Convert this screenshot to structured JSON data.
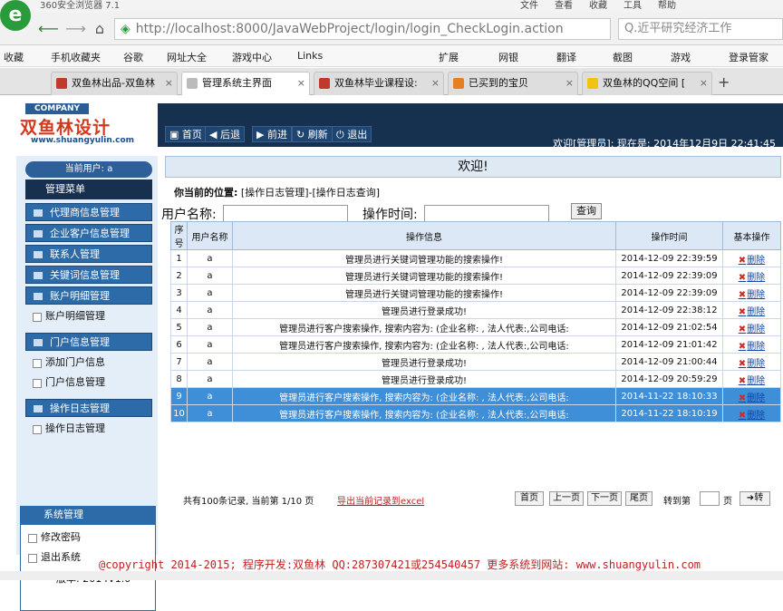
{
  "browser": {
    "title": "360安全浏览器 7.1",
    "menu": [
      "文件",
      "查看",
      "收藏",
      "工具",
      "帮助"
    ],
    "url": "http://localhost:8000/JavaWebProject/login/login_CheckLogin.action",
    "search": "Q.近平研究经济工作",
    "favorites": [
      "收藏",
      "手机收藏夹",
      "谷歌",
      "网址大全",
      "游戏中心",
      "Links",
      "扩展",
      "网银",
      "翻译",
      "截图",
      "游戏",
      "登录管家"
    ],
    "tabs": [
      {
        "label": "双鱼林出品-双鱼林",
        "color": "#c0392b"
      },
      {
        "label": "管理系统主界面",
        "color": "#999999"
      },
      {
        "label": "双鱼林毕业课程设:",
        "color": "#c0392b"
      },
      {
        "label": "已买到的宝贝",
        "color": "#e67e22"
      },
      {
        "label": "双鱼林的QQ空间 [",
        "color": "#f1c40f"
      }
    ]
  },
  "app": {
    "company": "COMPANY",
    "brand": "双鱼林设计",
    "brand_url": "www.shuangyulin.com",
    "toolbar": [
      "首页",
      "后退",
      "前进",
      "刷新",
      "退出"
    ],
    "welcome": "欢迎[管理员]: 现在是: 2014年12月9日 22:41:45",
    "current_user": "当前用户: a",
    "menu_title": "管理菜单",
    "sidebar": [
      {
        "type": "head",
        "label": "代理商信息管理"
      },
      {
        "type": "head",
        "label": "企业客户信息管理"
      },
      {
        "type": "head",
        "label": "联系人管理"
      },
      {
        "type": "head",
        "label": "关键词信息管理"
      },
      {
        "type": "head",
        "label": "账户明细管理"
      },
      {
        "type": "item",
        "label": "账户明细管理"
      },
      {
        "type": "head",
        "label": "门户信息管理"
      },
      {
        "type": "item",
        "label": "添加门户信息"
      },
      {
        "type": "item",
        "label": "门户信息管理"
      },
      {
        "type": "head",
        "label": "操作日志管理"
      },
      {
        "type": "item",
        "label": "操作日志管理"
      }
    ],
    "system": {
      "title": "系统管理",
      "items": [
        "修改密码",
        "退出系统"
      ],
      "version": "版本: 2014V1.0"
    },
    "main": {
      "welcome_bar": "欢迎!",
      "crumb_label": "你当前的位置:",
      "crumb": "[操作日志管理]-[操作日志查询]",
      "username_label": "用户名称:",
      "time_label": "操作时间:",
      "query": "查询",
      "columns": [
        "序号",
        "用户名称",
        "操作信息",
        "操作时间",
        "基本操作"
      ],
      "rows": [
        [
          "1",
          "a",
          "管理员进行关键词管理功能的搜索操作!",
          "2014-12-09 22:39:59",
          "删除"
        ],
        [
          "2",
          "a",
          "管理员进行关键词管理功能的搜索操作!",
          "2014-12-09 22:39:09",
          "删除"
        ],
        [
          "3",
          "a",
          "管理员进行关键词管理功能的搜索操作!",
          "2014-12-09 22:39:09",
          "删除"
        ],
        [
          "4",
          "a",
          "管理员进行登录成功!",
          "2014-12-09 22:38:12",
          "删除"
        ],
        [
          "5",
          "a",
          "管理员进行客户搜索操作, 搜索内容为: (企业名称: , 法人代表:,公司电话:",
          "2014-12-09 21:02:54",
          "删除"
        ],
        [
          "6",
          "a",
          "管理员进行客户搜索操作, 搜索内容为: (企业名称: , 法人代表:,公司电话:",
          "2014-12-09 21:01:42",
          "删除"
        ],
        [
          "7",
          "a",
          "管理员进行登录成功!",
          "2014-12-09 21:00:44",
          "删除"
        ],
        [
          "8",
          "a",
          "管理员进行登录成功!",
          "2014-12-09 20:59:29",
          "删除"
        ],
        [
          "9",
          "a",
          "管理员进行客户搜索操作, 搜索内容为: (企业名称: , 法人代表:,公司电话:",
          "2014-11-22 18:10:33",
          "删除"
        ],
        [
          "10",
          "a",
          "管理员进行客户搜索操作, 搜索内容为: (企业名称: , 法人代表:,公司电话:",
          "2014-11-22 18:10:19",
          "删除"
        ]
      ],
      "selected_rows": [
        8,
        9
      ],
      "pager_info": "共有100条记录, 当前第 1/10 页",
      "export": "导出当前记录到excel",
      "pager_buttons": [
        "首页",
        "上一页",
        "下一页",
        "尾页"
      ],
      "goto_label": "转到第",
      "page_unit": "页",
      "go": "转"
    },
    "footer": "@copyright 2014-2015; 程序开发:双鱼林  QQ:287307421或254540457  更多系统到网站: www.shuangyulin.com"
  }
}
